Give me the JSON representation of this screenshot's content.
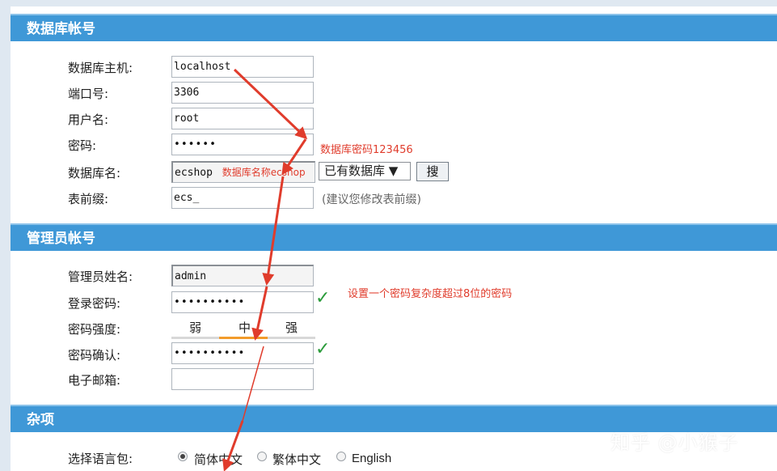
{
  "sections": {
    "db_account": "数据库帐号",
    "admin_account": "管理员帐号",
    "misc": "杂项"
  },
  "db": {
    "host_label": "数据库主机:",
    "host_value": "localhost",
    "port_label": "端口号:",
    "port_value": "3306",
    "user_label": "用户名:",
    "user_value": "root",
    "password_label": "密码:",
    "password_value": "••••••",
    "password_note": "数据库密码123456",
    "dbname_label": "数据库名:",
    "dbname_value": "ecshop",
    "dbname_note": "数据库名称ecshop",
    "existing_db_select": "已有数据库 ▼",
    "search_button": "搜",
    "prefix_label": "表前缀:",
    "prefix_value": "ecs_",
    "prefix_hint": "(建议您修改表前缀)"
  },
  "admin": {
    "name_label": "管理员姓名:",
    "name_value": "admin",
    "password_label": "登录密码:",
    "password_value": "••••••••••",
    "password_note": "设置一个密码复杂度超过8位的密码",
    "strength_label": "密码强度:",
    "strength_levels": [
      "弱",
      "中",
      "强"
    ],
    "strength_active_index": 1,
    "confirm_label": "密码确认:",
    "confirm_value": "••••••••••",
    "email_label": "电子邮箱:",
    "email_value": ""
  },
  "misc": {
    "language_label": "选择语言包:",
    "languages": [
      "简体中文",
      "繁体中文",
      "English"
    ],
    "selected_language_index": 0
  },
  "colors": {
    "header_bg": "#3f98d7",
    "annotation_red": "#e03c2c",
    "check_green": "#2a9b3a",
    "strength_active": "#f29b2b"
  },
  "watermark": "知乎 @小猴子"
}
